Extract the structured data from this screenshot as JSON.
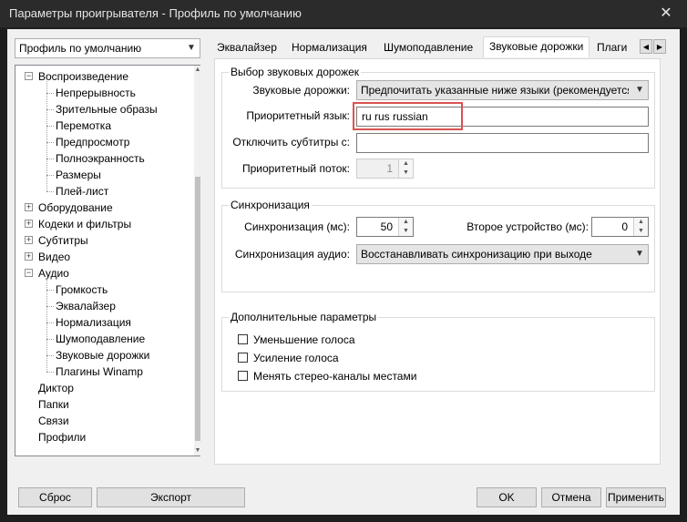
{
  "window": {
    "title": "Параметры проигрывателя - Профиль по умолчанию",
    "close_glyph": "✕"
  },
  "profile": {
    "selected": "Профиль по умолчанию"
  },
  "tree": {
    "items": [
      {
        "label": "Воспроизведение",
        "level": 0,
        "expander": "−"
      },
      {
        "label": "Непрерывность",
        "level": 1
      },
      {
        "label": "Зрительные образы",
        "level": 1
      },
      {
        "label": "Перемотка",
        "level": 1
      },
      {
        "label": "Предпросмотр",
        "level": 1
      },
      {
        "label": "Полноэкранность",
        "level": 1
      },
      {
        "label": "Размеры",
        "level": 1
      },
      {
        "label": "Плей-лист",
        "level": 1
      },
      {
        "label": "Оборудование",
        "level": 0,
        "expander": "+"
      },
      {
        "label": "Кодеки и фильтры",
        "level": 0,
        "expander": "+"
      },
      {
        "label": "Субтитры",
        "level": 0,
        "expander": "+"
      },
      {
        "label": "Видео",
        "level": 0,
        "expander": "+"
      },
      {
        "label": "Аудио",
        "level": 0,
        "expander": "−"
      },
      {
        "label": "Громкость",
        "level": 1
      },
      {
        "label": "Эквалайзер",
        "level": 1
      },
      {
        "label": "Нормализация",
        "level": 1
      },
      {
        "label": "Шумоподавление",
        "level": 1
      },
      {
        "label": "Звуковые дорожки",
        "level": 1
      },
      {
        "label": "Плагины Winamp",
        "level": 1
      },
      {
        "label": "Диктор",
        "level": 0
      },
      {
        "label": "Папки",
        "level": 0
      },
      {
        "label": "Связи",
        "level": 0
      },
      {
        "label": "Профили",
        "level": 0
      }
    ]
  },
  "tabs": [
    "Эквалайзер",
    "Нормализация",
    "Шумоподавление",
    "Звуковые дорожки",
    "Плаги"
  ],
  "active_tab": "Звуковые дорожки",
  "tab_nav": {
    "left": "◀",
    "right": "▶"
  },
  "group_tracks": {
    "legend": "Выбор звуковых дорожек",
    "tracks_label": "Звуковые дорожки:",
    "tracks_value": "Предпочитать указанные ниже языки (рекомендуется)",
    "lang_label": "Приоритетный язык:",
    "lang_value": "ru rus russian",
    "subs_label": "Отключить субтитры с:",
    "subs_value": "",
    "stream_label": "Приоритетный поток:",
    "stream_value": "1"
  },
  "group_sync": {
    "legend": "Синхронизация",
    "sync_label": "Синхронизация (мс):",
    "sync_value": "50",
    "second_label": "Второе устройство (мс):",
    "second_value": "0",
    "audio_label": "Синхронизация аудио:",
    "audio_value": "Восстанавливать синхронизацию при выходе"
  },
  "group_extra": {
    "legend": "Дополнительные параметры",
    "options": [
      "Уменьшение голоса",
      "Усиление голоса",
      "Менять стерео-каналы местами"
    ]
  },
  "buttons": {
    "reset": "Сброс",
    "export": "Экспорт",
    "ok": "OK",
    "cancel": "Отмена",
    "apply": "Применить"
  },
  "colors": {
    "highlight": "#d9534f",
    "titlebar": "#2b2b2b"
  }
}
